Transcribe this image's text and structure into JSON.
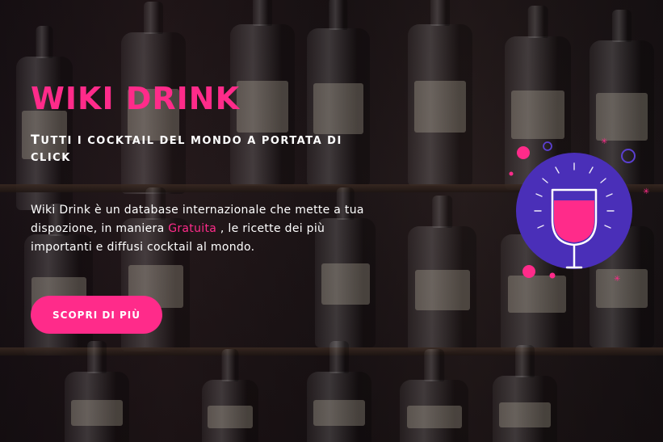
{
  "hero": {
    "title": "WIKI DRINK",
    "subtitle_first": "T",
    "subtitle_rest": "utti i cocktail del mondo a portata di click",
    "description_before": "Wiki Drink è un database internazionale che mette a tua dispozione, in maniera ",
    "description_highlight": "Gratuita",
    "description_after": " , le ricette dei più importanti e diffusi cocktail al mondo.",
    "cta_label": "SCOPRI DI PIÙ"
  },
  "illustration": {
    "icon": "wine-glass-icon",
    "circle_color": "#4a2fb8",
    "wine_color": "#ff2b8a"
  },
  "colors": {
    "accent": "#ff2b8a",
    "text": "#ffffff",
    "background": "#150f12"
  }
}
